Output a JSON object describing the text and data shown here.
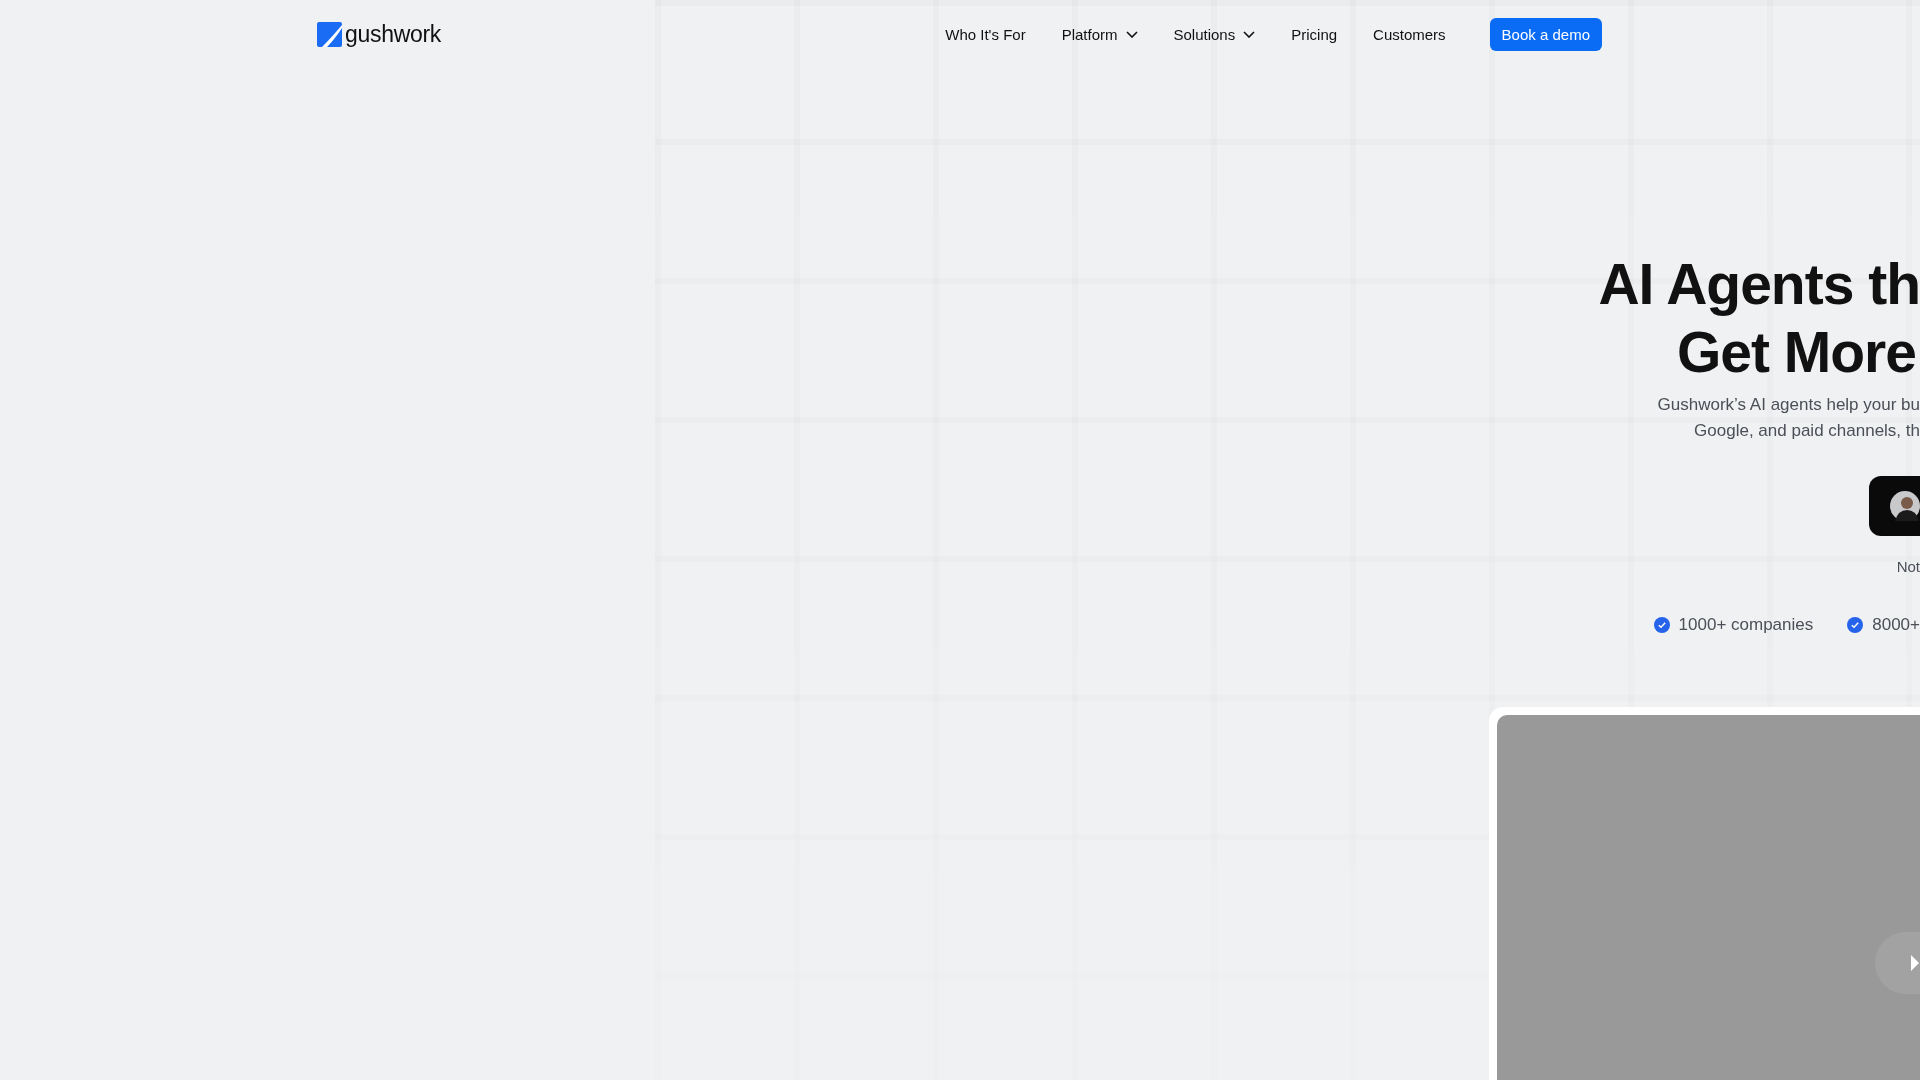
{
  "header": {
    "logo": "gushwork",
    "nav": [
      {
        "label": "Who It's For",
        "dropdown": false
      },
      {
        "label": "Platform",
        "dropdown": true
      },
      {
        "label": "Solutions",
        "dropdown": true
      },
      {
        "label": "Pricing",
        "dropdown": false
      },
      {
        "label": "Customers",
        "dropdown": false
      }
    ],
    "cta": "Book a demo"
  },
  "hero": {
    "title_lines": [
      "AI Agents th",
      "Get More"
    ],
    "subtitle_lines": [
      "Gushwork’s AI agents help your bu",
      "Google, and paid channels, th"
    ],
    "note": "Not",
    "stats": [
      "1000+ companies",
      "8000+"
    ]
  }
}
